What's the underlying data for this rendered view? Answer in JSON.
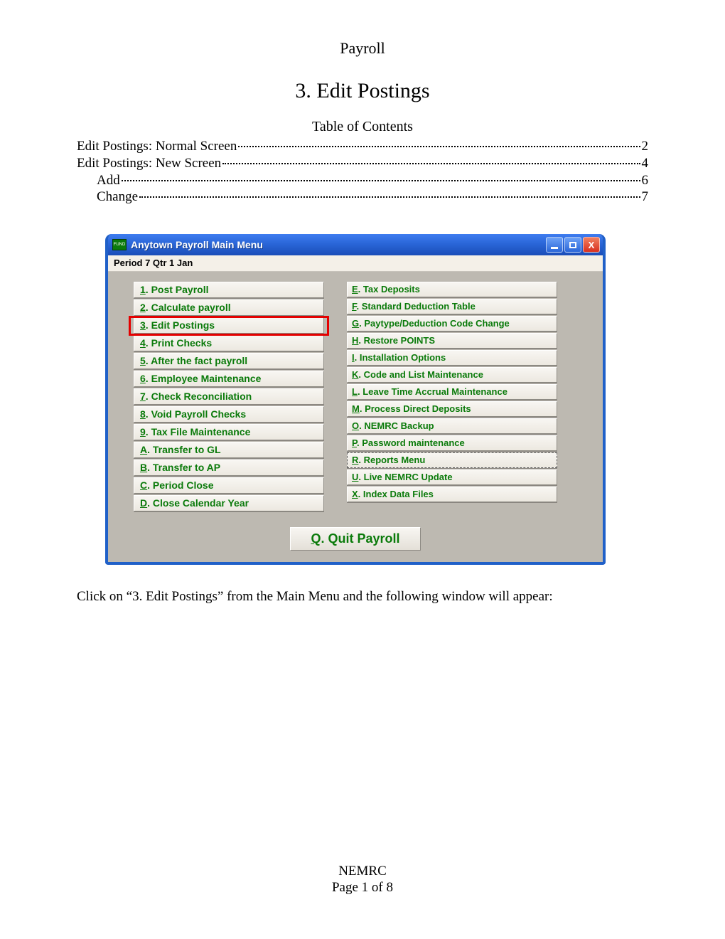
{
  "header": {
    "payroll": "Payroll",
    "section": "3. Edit Postings",
    "toc_title": "Table of Contents"
  },
  "toc": [
    {
      "label": "Edit Postings: Normal Screen",
      "page": "2",
      "indent": 0
    },
    {
      "label": "Edit Postings: New Screen",
      "page": "4",
      "indent": 0
    },
    {
      "label": "Add",
      "page": "6",
      "indent": 1
    },
    {
      "label": "Change",
      "page": "7",
      "indent": 1
    }
  ],
  "window": {
    "title": "Anytown Payroll  Main Menu",
    "period": "Period 7 Qtr 1 Jan",
    "left_menu": [
      {
        "key": "1",
        "label": "Post Payroll"
      },
      {
        "key": "2",
        "label": "Calculate payroll"
      },
      {
        "key": "3",
        "label": "Edit Postings",
        "highlight": true
      },
      {
        "key": "4",
        "label": "Print Checks"
      },
      {
        "key": "5",
        "label": "After the fact payroll"
      },
      {
        "key": "6",
        "label": "Employee Maintenance"
      },
      {
        "key": "7",
        "label": "Check Reconciliation"
      },
      {
        "key": "8",
        "label": "Void Payroll Checks"
      },
      {
        "key": "9",
        "label": "Tax File Maintenance"
      },
      {
        "key": "A",
        "label": "Transfer to GL"
      },
      {
        "key": "B",
        "label": "Transfer to AP"
      },
      {
        "key": "C",
        "label": "Period Close"
      },
      {
        "key": "D",
        "label": "Close Calendar Year"
      }
    ],
    "right_menu": [
      {
        "key": "E",
        "label": "Tax Deposits"
      },
      {
        "key": "F",
        "label": "Standard Deduction Table"
      },
      {
        "key": "G",
        "label": "Paytype/Deduction Code Change"
      },
      {
        "key": "H",
        "label": " Restore POINTS"
      },
      {
        "key": "I",
        "label": " Installation Options"
      },
      {
        "key": "K",
        "label": "Code and List Maintenance"
      },
      {
        "key": "L",
        "label": "Leave Time Accrual Maintenance"
      },
      {
        "key": "M",
        "label": "Process Direct Deposits"
      },
      {
        "key": "O",
        "label": "NEMRC Backup"
      },
      {
        "key": "P",
        "label": " Password maintenance"
      },
      {
        "key": "R",
        "label": " Reports Menu",
        "dashed": true
      },
      {
        "key": "U",
        "label": "Live NEMRC Update"
      },
      {
        "key": "X",
        "label": " Index Data Files"
      }
    ],
    "quit": {
      "key": "Q",
      "label": "Quit Payroll"
    }
  },
  "instruction": "Click on “3. Edit Postings” from the Main Menu and the following window will appear:",
  "footer": {
    "org": "NEMRC",
    "page": "Page 1 of 8"
  }
}
